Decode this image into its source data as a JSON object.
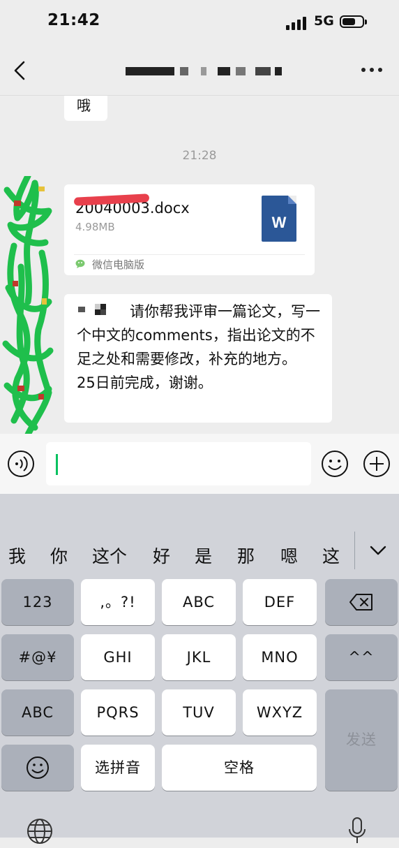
{
  "status_bar": {
    "time": "21:42",
    "network": "5G"
  },
  "nav": {
    "back_icon": "chevron-left-icon",
    "more_icon": "more-dots-icon"
  },
  "chat": {
    "messages": [
      {
        "type": "text",
        "text": "哦"
      },
      {
        "type": "timestamp",
        "text": "21:28"
      },
      {
        "type": "file",
        "file_name": "20040003.docx",
        "file_size": "4.98MB",
        "source": "微信电脑版",
        "file_icon_letter": "W"
      },
      {
        "type": "text",
        "text": "请你帮我评审一篇论文，写一个中文的comments，指出论文的不足之处和需要修改，补充的地方。　　25日前完成，谢谢。"
      }
    ]
  },
  "input_bar": {
    "value": ""
  },
  "keyboard": {
    "candidates": [
      "我",
      "你",
      "这个",
      "好",
      "是",
      "那",
      "嗯",
      "这"
    ],
    "rows": [
      [
        "123",
        ",。?!",
        "ABC",
        "DEF"
      ],
      [
        "#@¥",
        "GHI",
        "JKL",
        "MNO",
        "^^"
      ],
      [
        "ABC",
        "PQRS",
        "TUV",
        "WXYZ",
        "发送"
      ],
      [
        "选拼音",
        "空格"
      ]
    ]
  },
  "colors": {
    "accent_green": "#07c160",
    "word_blue": "#2b5797",
    "background": "#ededed"
  }
}
